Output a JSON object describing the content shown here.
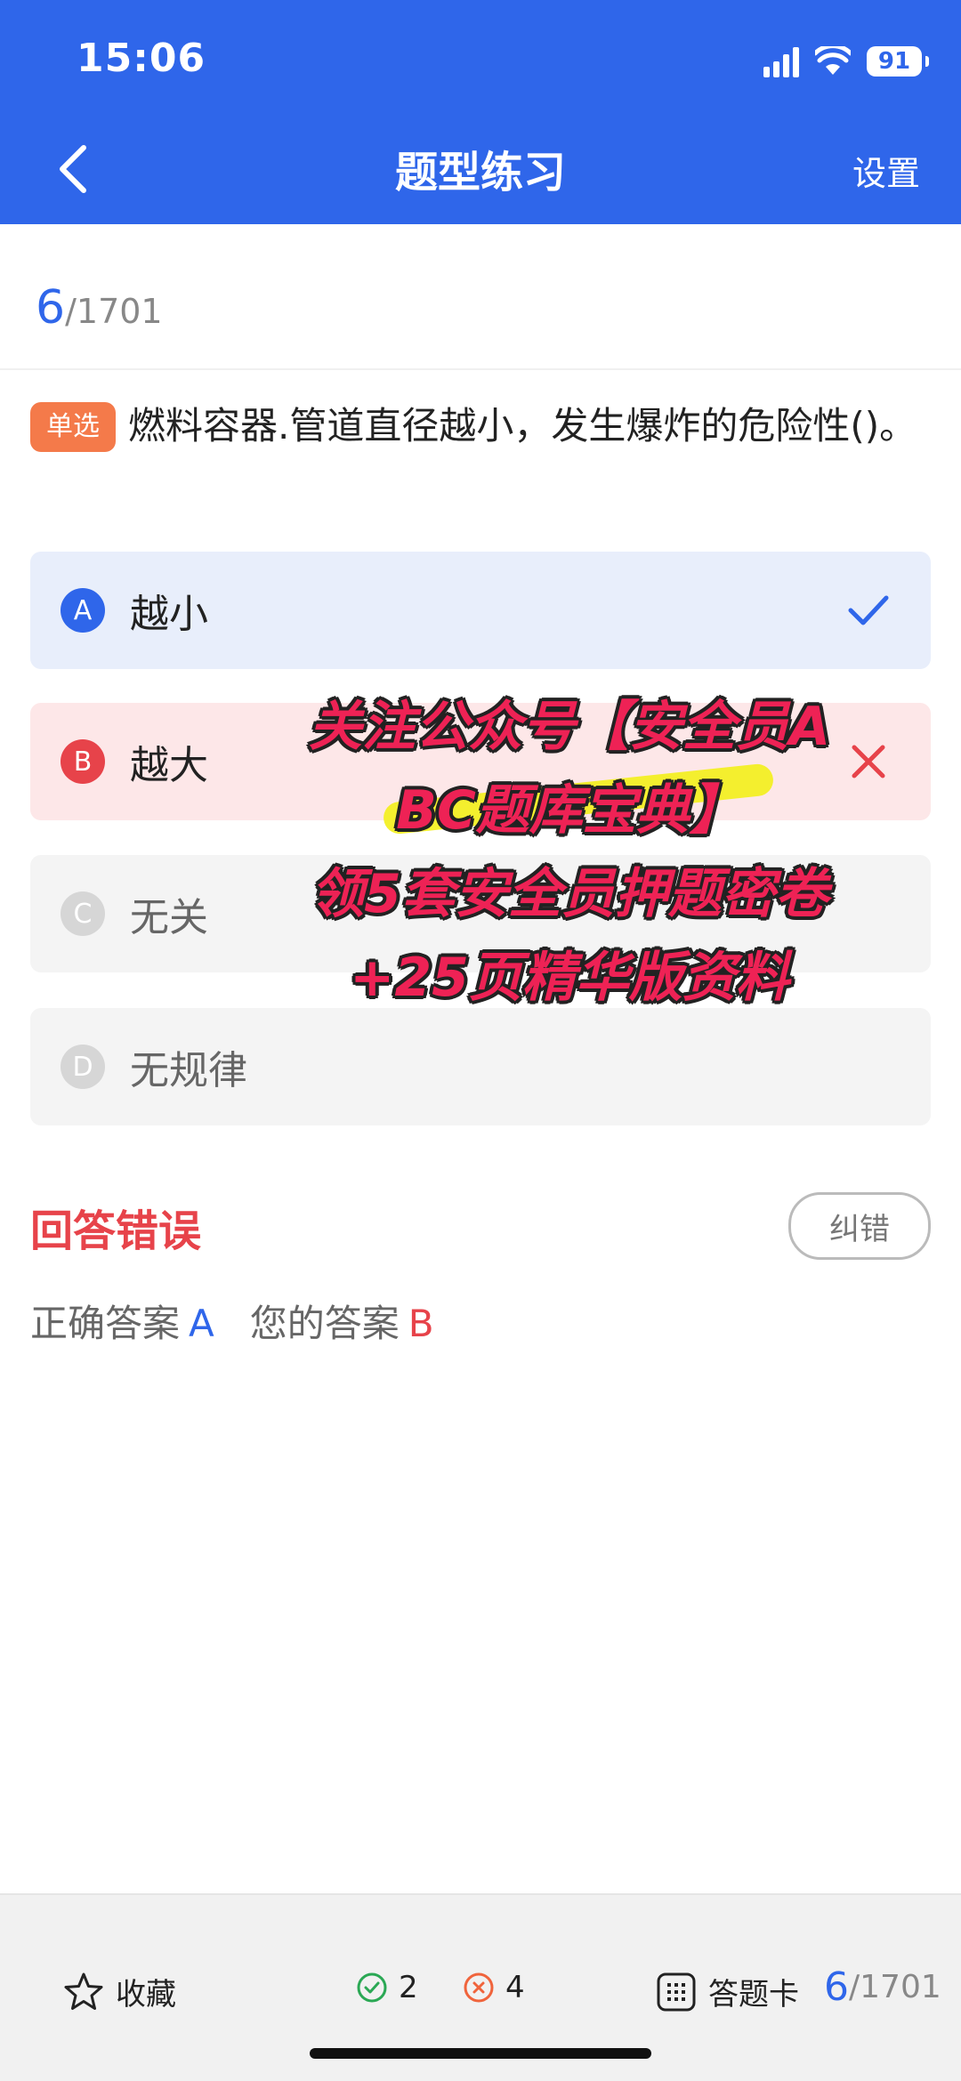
{
  "status_bar": {
    "time": "15:06",
    "battery": "91"
  },
  "nav": {
    "title": "题型练习",
    "settings": "设置"
  },
  "progress": {
    "current": "6",
    "total": "/1701"
  },
  "question": {
    "type_badge": "单选",
    "text": "燃料容器.管道直径越小，发生爆炸的危险性()。"
  },
  "options": [
    {
      "letter": "A",
      "text": "越小",
      "state": "correct"
    },
    {
      "letter": "B",
      "text": "越大",
      "state": "wrong"
    },
    {
      "letter": "C",
      "text": "无关",
      "state": "neutral"
    },
    {
      "letter": "D",
      "text": "无规律",
      "state": "neutral"
    }
  ],
  "promo": {
    "lines": [
      "关注公众号【安全员A",
      "BC题库宝典】",
      "领5套安全员押题密卷",
      "+25页精华版资料"
    ]
  },
  "result": {
    "title": "回答错误",
    "report_button": "纠错",
    "correct_label": "正确答案",
    "correct_value": "A",
    "mine_label": "您的答案",
    "mine_value": "B"
  },
  "bottom_bar": {
    "favorite": "收藏",
    "right_count": "2",
    "wrong_count": "4",
    "answer_card": "答题卡",
    "progress_current": "6",
    "progress_total": "/1701"
  },
  "colors": {
    "primary": "#2f66ea",
    "error": "#e7434a",
    "badge": "#f47a4a"
  }
}
